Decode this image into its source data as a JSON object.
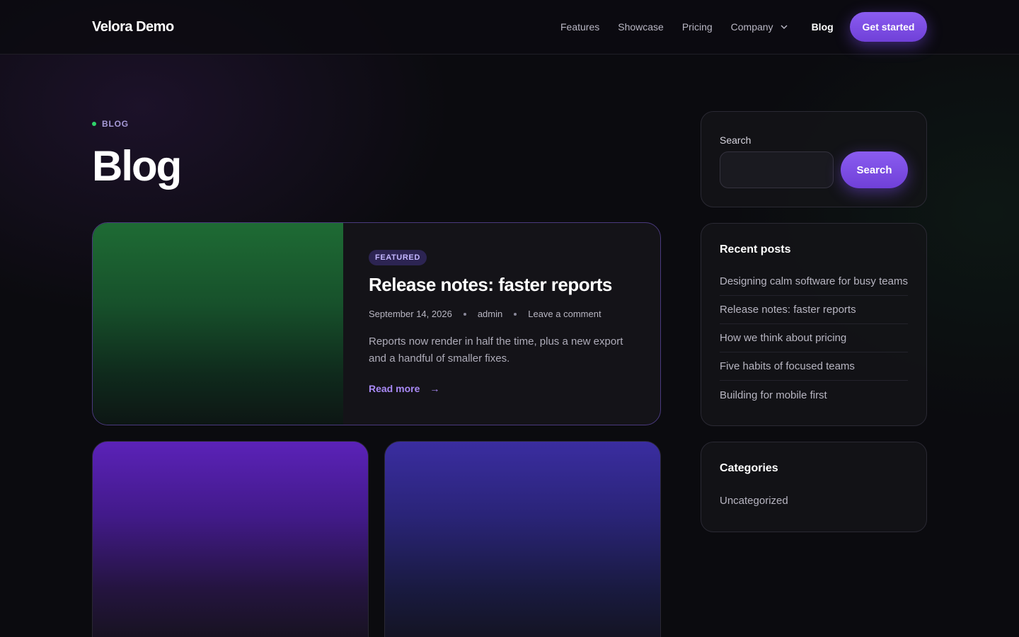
{
  "header": {
    "brand": "Velora Demo",
    "nav": [
      "Features",
      "Showcase",
      "Pricing",
      "Company"
    ],
    "active": "Blog",
    "cta": "Get started"
  },
  "hero": {
    "eyebrow": "BLOG",
    "title": "Blog"
  },
  "featured": {
    "tag": "FEATURED",
    "title": "Release notes: faster reports",
    "date": "September 14, 2026",
    "author": "admin",
    "comments": "Leave a comment",
    "excerpt": "Reports now render in half the time, plus a new export and a handful of smaller fixes.",
    "read_more": "Read more",
    "arrow": "→"
  },
  "sidebar": {
    "search": {
      "label": "Search",
      "placeholder": "",
      "button": "Search"
    },
    "recent": {
      "title": "Recent posts",
      "items": [
        "Designing calm software for busy teams",
        "Release notes: faster reports",
        "How we think about pricing",
        "Five habits of focused teams",
        "Building for mobile first"
      ]
    },
    "categories": {
      "title": "Categories",
      "items": [
        "Uncategorized"
      ]
    }
  },
  "colors": {
    "accent": "#7c4df0",
    "status_dot": "#2fd36a",
    "featured_image": "#1e6b34",
    "card_1": "#5b22b8",
    "card_2": "#3a2da0"
  }
}
